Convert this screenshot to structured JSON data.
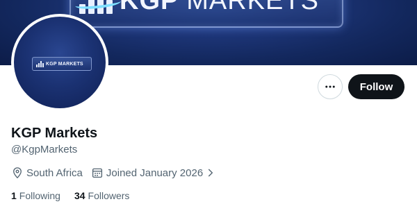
{
  "banner": {
    "logo_word1": "KGP",
    "logo_word2": "MARKETS"
  },
  "avatar": {
    "logo_text": "KGP MARKETS"
  },
  "actions": {
    "more_icon": "more-horizontal-icon",
    "follow_label": "Follow"
  },
  "profile": {
    "display_name": "KGP Markets",
    "handle": "@KgpMarkets",
    "location": "South Africa",
    "location_icon": "location-pin-icon",
    "joined": "Joined January 2026",
    "joined_icon": "calendar-icon",
    "joined_chevron_icon": "chevron-right-icon"
  },
  "stats": {
    "following_count": "1",
    "following_label": "Following",
    "followers_count": "34",
    "followers_label": "Followers"
  },
  "colors": {
    "primary_text": "#0f1419",
    "secondary_text": "#536471",
    "banner_blue": "#1d3577",
    "follow_button_bg": "#0f1419"
  }
}
